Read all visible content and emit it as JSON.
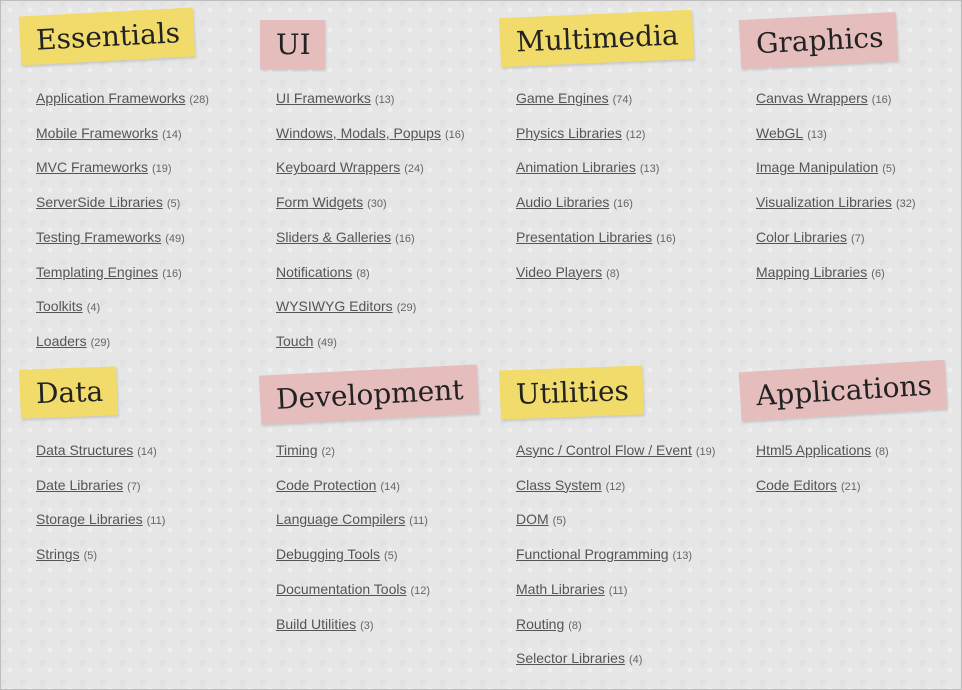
{
  "sections": [
    {
      "title": "Essentials",
      "color": "#f1db6a",
      "items": [
        {
          "label": "Application Frameworks",
          "count": "(28)"
        },
        {
          "label": "Mobile Frameworks",
          "count": "(14)"
        },
        {
          "label": "MVC Frameworks",
          "count": "(19)"
        },
        {
          "label": "ServerSide Libraries",
          "count": "(5)"
        },
        {
          "label": "Testing Frameworks",
          "count": "(49)"
        },
        {
          "label": "Templating Engines",
          "count": "(16)"
        },
        {
          "label": "Toolkits",
          "count": "(4)"
        },
        {
          "label": "Loaders",
          "count": "(29)"
        }
      ]
    },
    {
      "title": "UI",
      "color": "#e5bdbd",
      "items": [
        {
          "label": "UI Frameworks",
          "count": "(13)"
        },
        {
          "label": "Windows, Modals, Popups",
          "count": "(16)"
        },
        {
          "label": "Keyboard Wrappers",
          "count": "(24)"
        },
        {
          "label": "Form Widgets",
          "count": "(30)"
        },
        {
          "label": "Sliders & Galleries",
          "count": "(16)"
        },
        {
          "label": "Notifications",
          "count": "(8)"
        },
        {
          "label": "WYSIWYG Editors",
          "count": "(29)"
        },
        {
          "label": "Touch",
          "count": "(49)"
        }
      ]
    },
    {
      "title": "Multimedia",
      "color": "#f1db6a",
      "items": [
        {
          "label": "Game Engines",
          "count": "(74)"
        },
        {
          "label": "Physics Libraries",
          "count": "(12)"
        },
        {
          "label": "Animation Libraries",
          "count": "(13)"
        },
        {
          "label": "Audio Libraries",
          "count": "(16)"
        },
        {
          "label": "Presentation Libraries",
          "count": "(16)"
        },
        {
          "label": "Video Players",
          "count": "(8)"
        }
      ]
    },
    {
      "title": "Graphics",
      "color": "#e5bdbd",
      "items": [
        {
          "label": "Canvas Wrappers",
          "count": "(16)"
        },
        {
          "label": "WebGL",
          "count": "(13)"
        },
        {
          "label": "Image Manipulation",
          "count": "(5)"
        },
        {
          "label": "Visualization Libraries",
          "count": "(32)"
        },
        {
          "label": "Color Libraries",
          "count": "(7)"
        },
        {
          "label": "Mapping Libraries",
          "count": "(6)"
        }
      ]
    },
    {
      "title": "Data",
      "color": "#f1db6a",
      "items": [
        {
          "label": "Data Structures",
          "count": "(14)"
        },
        {
          "label": "Date Libraries",
          "count": "(7)"
        },
        {
          "label": "Storage Libraries",
          "count": "(11)"
        },
        {
          "label": "Strings",
          "count": "(5)"
        }
      ]
    },
    {
      "title": "Development",
      "color": "#e5bdbd",
      "items": [
        {
          "label": "Timing",
          "count": "(2)"
        },
        {
          "label": "Code Protection",
          "count": "(14)"
        },
        {
          "label": "Language Compilers",
          "count": "(11)"
        },
        {
          "label": "Debugging Tools",
          "count": "(5)"
        },
        {
          "label": "Documentation Tools",
          "count": "(12)"
        },
        {
          "label": "Build Utilities",
          "count": "(3)"
        }
      ]
    },
    {
      "title": "Utilities",
      "color": "#f1db6a",
      "items": [
        {
          "label": "Async / Control Flow / Event",
          "count": "(19)"
        },
        {
          "label": "Class System",
          "count": "(12)"
        },
        {
          "label": "DOM",
          "count": "(5)"
        },
        {
          "label": "Functional Programming",
          "count": "(13)"
        },
        {
          "label": "Math Libraries",
          "count": "(11)"
        },
        {
          "label": "Routing",
          "count": "(8)"
        },
        {
          "label": "Selector Libraries",
          "count": "(4)"
        }
      ]
    },
    {
      "title": "Applications",
      "color": "#e5bdbd",
      "items": [
        {
          "label": "Html5 Applications",
          "count": "(8)"
        },
        {
          "label": "Code Editors",
          "count": "(21)"
        }
      ]
    }
  ]
}
